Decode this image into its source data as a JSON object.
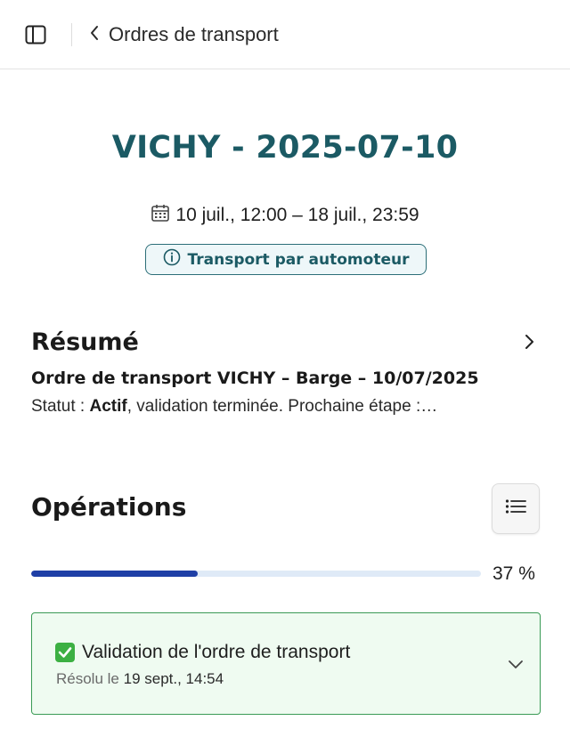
{
  "header": {
    "sidebar_toggle_icon": "sidebar-panel-icon",
    "back_icon": "chevron-left-icon",
    "back_label": "Ordres de transport"
  },
  "hero": {
    "title": "VICHY - 2025-07-10",
    "date_icon": "calendar-icon",
    "date_range": "10 juil., 12:00 – 18 juil., 23:59",
    "badge_icon": "info-icon",
    "badge_label": "Transport par automoteur"
  },
  "summary": {
    "title": "Résumé",
    "subtitle": "Ordre de transport VICHY – Barge – 10/07/2025",
    "status_prefix": "Statut : ",
    "status_value": "Actif",
    "status_suffix": ", validation terminée. Prochaine étape :…"
  },
  "operations": {
    "title": "Opérations",
    "list_icon": "list-icon",
    "progress_percent": 37,
    "progress_label": "37 %",
    "items": [
      {
        "status_icon": "check-box-icon",
        "title": "Validation de l'ordre de transport",
        "meta_label": "Résolu le",
        "meta_date": "19 sept., 14:54",
        "expand_icon": "chevron-down-icon"
      }
    ]
  },
  "colors": {
    "accent": "#1b5a64",
    "progress": "#1f3fa6",
    "success_border": "#3a9a55",
    "success_bg": "#effbf1"
  }
}
